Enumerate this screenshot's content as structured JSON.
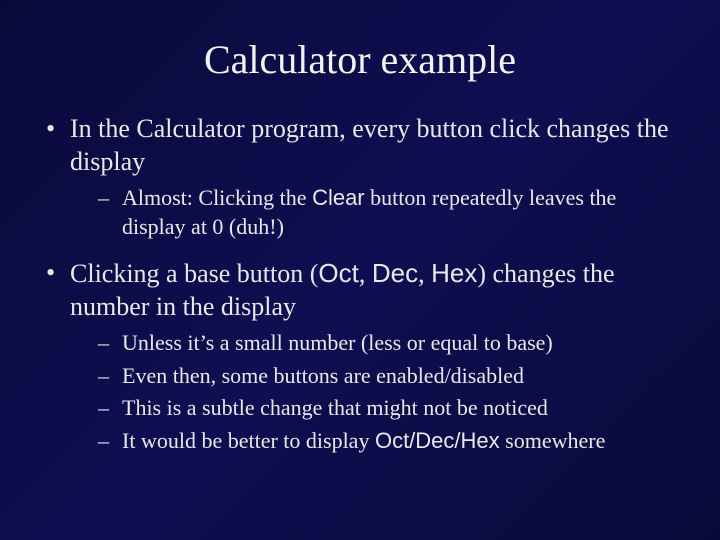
{
  "title": "Calculator example",
  "bullets": {
    "b1_pre": "In the Calculator program, every button click changes the display",
    "b1_sub1_a": "Almost: Clicking the ",
    "b1_sub1_code": "Clear",
    "b1_sub1_b": " button repeatedly leaves the display at 0  (duh!)",
    "b2_a": "Clicking a base button (",
    "b2_oct": "Oct",
    "b2_sep1": ", ",
    "b2_dec": "Dec",
    "b2_sep2": ", ",
    "b2_hex": "Hex",
    "b2_b": ") changes the number in the display",
    "b2_sub1": "Unless it’s a small number (less or equal to base)",
    "b2_sub2": "Even then, some buttons are enabled/disabled",
    "b2_sub3": "This is a subtle change that might not be noticed",
    "b2_sub4_a": "It would be better to display ",
    "b2_sub4_code": "Oct/Dec/Hex",
    "b2_sub4_b": " somewhere"
  }
}
